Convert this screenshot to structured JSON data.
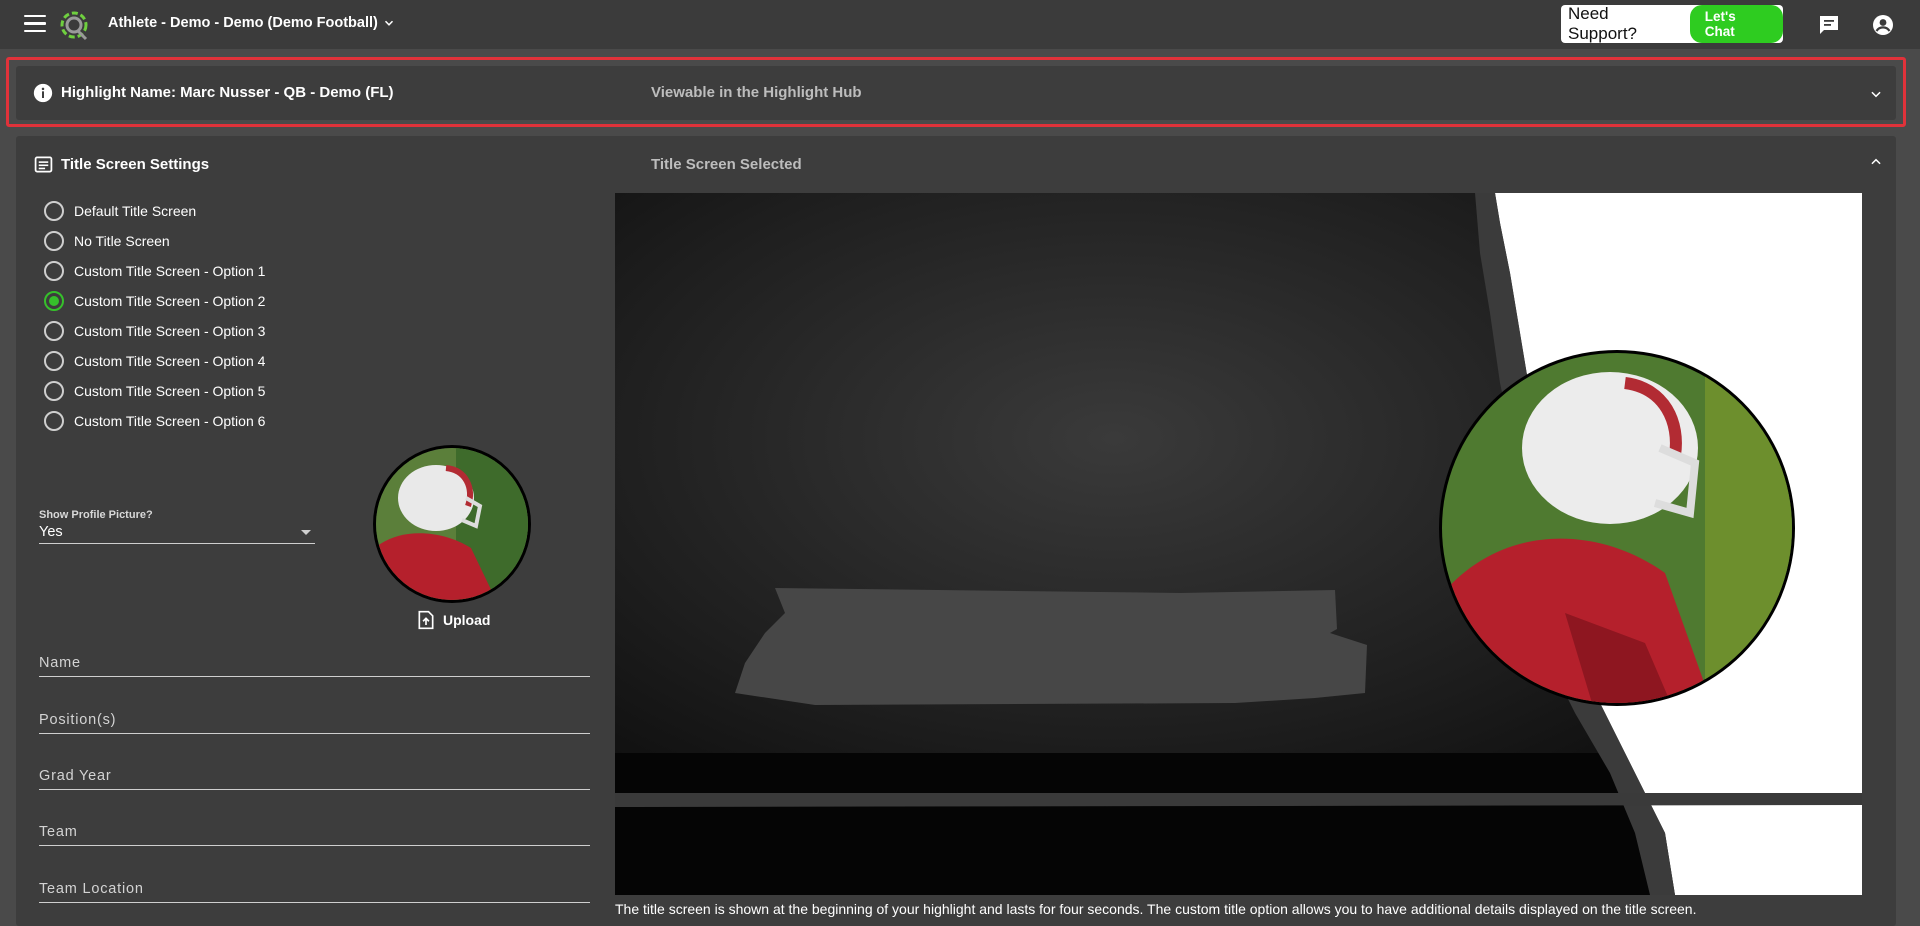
{
  "topbar": {
    "title": "Athlete - Demo - Demo (Demo Football)",
    "support_text": "Need Support?",
    "chat_label": "Let's Chat",
    "icons": [
      "menu-icon",
      "app-logo",
      "chevron-down-icon",
      "message-icon",
      "account-circle-icon"
    ]
  },
  "highlight_panel": {
    "title": "Highlight Name: Marc Nusser - QB - Demo (FL)",
    "status": "Viewable in the Highlight Hub"
  },
  "title_screen": {
    "title": "Title Screen Settings",
    "selected_label": "Title Screen Selected",
    "options": [
      {
        "label": "Default Title Screen",
        "checked": false
      },
      {
        "label": "No Title Screen",
        "checked": false
      },
      {
        "label": "Custom Title Screen - Option 1",
        "checked": false
      },
      {
        "label": "Custom Title Screen - Option 2",
        "checked": true
      },
      {
        "label": "Custom Title Screen - Option 3",
        "checked": false
      },
      {
        "label": "Custom Title Screen - Option 4",
        "checked": false
      },
      {
        "label": "Custom Title Screen - Option 5",
        "checked": false
      },
      {
        "label": "Custom Title Screen - Option 6",
        "checked": false
      }
    ],
    "profile_picture": {
      "label": "Show Profile Picture?",
      "value": "Yes"
    },
    "upload_label": "Upload",
    "fields": {
      "name": {
        "placeholder": "Name",
        "value": ""
      },
      "positions": {
        "placeholder": "Position(s)",
        "value": ""
      },
      "grad_year": {
        "placeholder": "Grad Year",
        "value": ""
      },
      "team": {
        "placeholder": "Team",
        "value": ""
      },
      "team_location": {
        "placeholder": "Team Location",
        "value": ""
      }
    },
    "caption": "The title screen is shown at the beginning of your highlight and lasts for four seconds. The custom title option allows you to have additional details displayed on the title screen."
  },
  "colors": {
    "accent_green": "#36c12b",
    "highlight_outline": "#e0323a",
    "panel_bg": "#3d3d3d",
    "page_bg": "#4a4a4a"
  }
}
